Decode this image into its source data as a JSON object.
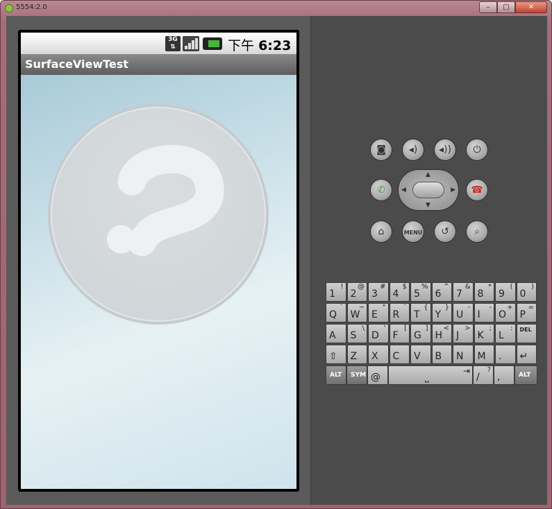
{
  "window": {
    "title": "5554:2.0",
    "minimize": "–",
    "maximize": "□",
    "close": "✕"
  },
  "status_bar": {
    "network": "3G",
    "time_prefix": "下午",
    "time": "6:23"
  },
  "app": {
    "title": "SurfaceViewTest"
  },
  "controls": {
    "camera": "camera-icon",
    "volume_down": "volume-down-icon",
    "volume_up": "volume-up-icon",
    "power": "power-icon",
    "call": "call-icon",
    "end_call": "end-call-icon",
    "home": "home-icon",
    "menu": "MENU",
    "back": "back-icon",
    "search": "search-icon"
  },
  "keyboard": {
    "row1": [
      [
        "1",
        "!"
      ],
      [
        "2",
        "@"
      ],
      [
        "3",
        "#"
      ],
      [
        "4",
        "$"
      ],
      [
        "5",
        "%"
      ],
      [
        "6",
        "^"
      ],
      [
        "7",
        "&"
      ],
      [
        "8",
        "*"
      ],
      [
        "9",
        "("
      ],
      [
        "0",
        ")"
      ]
    ],
    "row2": [
      [
        "Q",
        "`"
      ],
      [
        "W",
        "~"
      ],
      [
        "E",
        "\""
      ],
      [
        "R",
        "`"
      ],
      [
        "T",
        "{"
      ],
      [
        "Y",
        "}"
      ],
      [
        "U",
        "-"
      ],
      [
        "I",
        "-"
      ],
      [
        "O",
        "+"
      ],
      [
        "P",
        "="
      ]
    ],
    "row3": [
      [
        "A",
        ""
      ],
      [
        "S",
        "\\"
      ],
      [
        "D",
        "'"
      ],
      [
        "F",
        "["
      ],
      [
        "G",
        "]"
      ],
      [
        "H",
        "<"
      ],
      [
        "J",
        ">"
      ],
      [
        "K",
        ";"
      ],
      [
        "L",
        ":"
      ],
      [
        "DEL",
        ""
      ]
    ],
    "row4": [
      [
        "⇧",
        ""
      ],
      [
        "Z",
        ""
      ],
      [
        "X",
        ""
      ],
      [
        "C",
        ""
      ],
      [
        "V",
        ""
      ],
      [
        "B",
        ""
      ],
      [
        "N",
        ""
      ],
      [
        "M",
        ""
      ],
      [
        ".",
        ""
      ],
      [
        "↵",
        ""
      ]
    ],
    "row5": {
      "alt_left": "ALT",
      "sym": "SYM",
      "at": "@",
      "space": "⎵",
      "tab": "⇥",
      "slash": "/",
      "question": "?",
      "comma": ",",
      "alt_right": "ALT"
    }
  },
  "colors": {
    "accent_battery": "#49b33b",
    "call_green": "#3a9b3a",
    "end_call_red": "#c23030"
  }
}
